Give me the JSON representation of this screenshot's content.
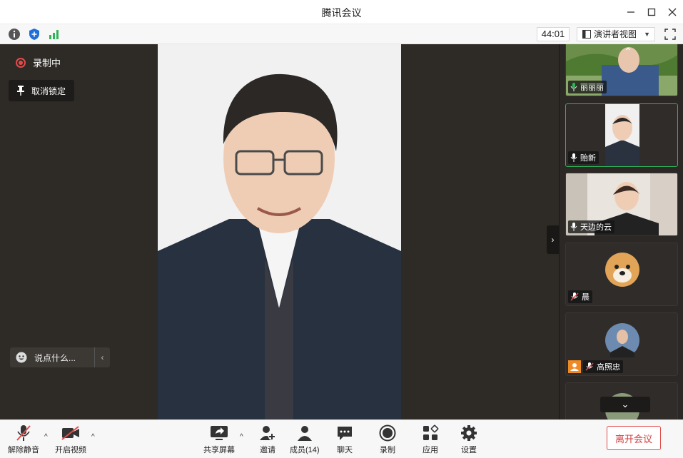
{
  "window": {
    "title": "腾讯会议"
  },
  "infobar": {
    "timer": "44:01",
    "view_mode": "演讲者视图"
  },
  "stage": {
    "recording_label": "录制中",
    "unpin_label": "取消锁定",
    "chat_placeholder": "说点什么..."
  },
  "participants": [
    {
      "name": "丽丽丽"
    },
    {
      "name": "贻新"
    },
    {
      "name": "天边的云"
    },
    {
      "name": "晨"
    },
    {
      "name": "高照忠"
    }
  ],
  "toolbar": {
    "unmute": "解除静音",
    "start_video": "开启视频",
    "share_screen": "共享屏幕",
    "invite": "邀请",
    "members": "成员(14)",
    "chat": "聊天",
    "record": "录制",
    "apps": "应用",
    "settings": "设置",
    "leave": "离开会议"
  },
  "colors": {
    "accent_green": "#2fb35a",
    "danger_red": "#e14a4a",
    "stage_bg": "#2e2a26"
  }
}
